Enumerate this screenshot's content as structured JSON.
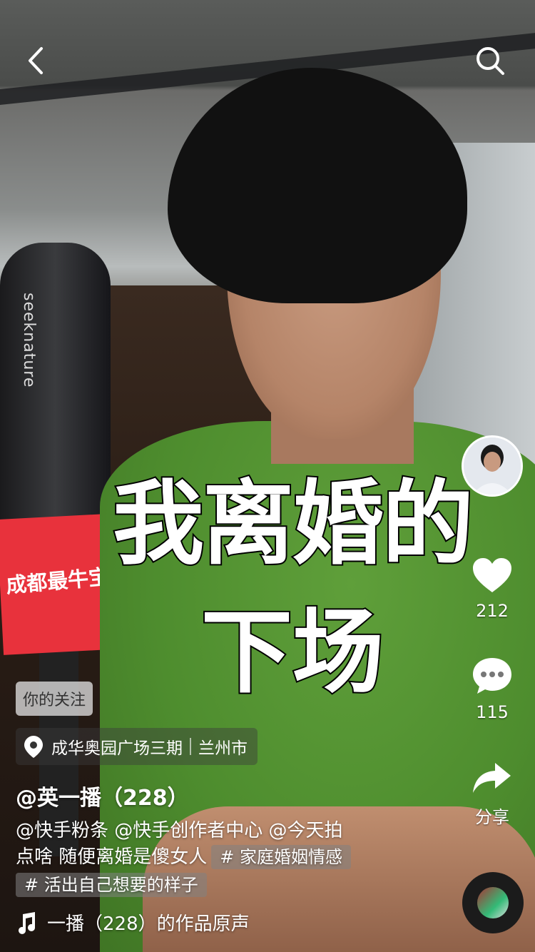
{
  "header": {
    "back_icon": "chevron-left-icon",
    "search_icon": "search-icon"
  },
  "video": {
    "title_line1": "我离婚的",
    "title_line2": "下场",
    "mic_brand": "seeknature",
    "mic_sign_text": "成都最牛宝妈"
  },
  "sidebar": {
    "avatar_icon": "avatar",
    "like_count": "212",
    "comment_count": "115",
    "share_label": "分享"
  },
  "info": {
    "follow_tag": "你的关注",
    "location_name": "成华奥园广场三期",
    "location_city": "兰州市",
    "author": "@英一播（228）",
    "desc_line1": "@快手粉条 @快手创作者中心 @今天拍",
    "desc_line2": "点啥 随便离婚是傻女人",
    "hashtag1": "# 家庭婚姻情感",
    "hashtag2": "# 活出自己想要的样子",
    "music": "一播（228）的作品原声"
  },
  "colors": {
    "shirt": "#4e8d2e",
    "sign": "#e8323c"
  }
}
